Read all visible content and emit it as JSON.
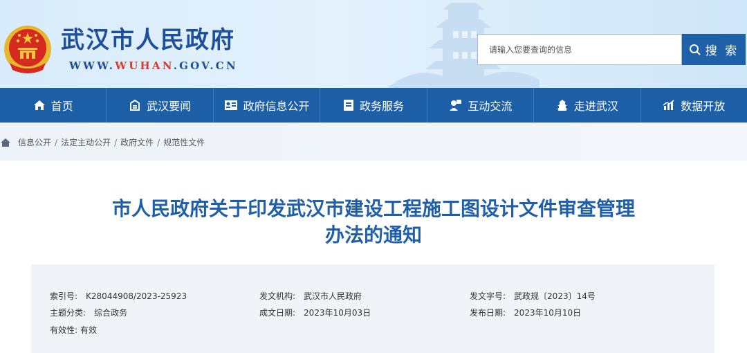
{
  "header": {
    "site_title": "武汉市人民政府",
    "site_url_prefix": "WWW.",
    "site_url_highlight": "WUHAN",
    "site_url_suffix": ".GOV.CN",
    "search_placeholder": "请输入您要查询的信息",
    "search_button": "搜 索"
  },
  "nav": {
    "items": [
      {
        "label": "首页",
        "icon": "home-icon"
      },
      {
        "label": "武汉要闻",
        "icon": "news-icon"
      },
      {
        "label": "政府信息公开",
        "icon": "info-card-icon"
      },
      {
        "label": "政务服务",
        "icon": "service-icon"
      },
      {
        "label": "互动交流",
        "icon": "chat-icon"
      },
      {
        "label": "走进武汉",
        "icon": "tower-icon"
      },
      {
        "label": "数据开放",
        "icon": "chart-icon"
      }
    ]
  },
  "breadcrumb": [
    "信息公开",
    "法定主动公开",
    "政府文件",
    "规范性文件"
  ],
  "document": {
    "title_line1": "市人民政府关于印发武汉市建设工程施工图设计文件审查管理",
    "title_line2": "办法的通知"
  },
  "info": {
    "index_no": {
      "label": "索引号:",
      "value": "K28044908/2023-25923"
    },
    "issuer": {
      "label": "发文机构:",
      "value": "武汉市人民政府"
    },
    "doc_no": {
      "label": "发文字号:",
      "value": "武政规〔2023〕14号"
    },
    "category": {
      "label": "主题分类:",
      "value": "综合政务"
    },
    "created": {
      "label": "成文日期:",
      "value": "2023年10月03日"
    },
    "published": {
      "label": "发布日期:",
      "value": "2023年10月10日"
    },
    "validity": {
      "label": "有效性:",
      "value": "有效"
    }
  },
  "colors": {
    "primary_blue": "#1c5fa6",
    "title_blue": "#1f5ea8",
    "url_red": "#d63a2b"
  }
}
